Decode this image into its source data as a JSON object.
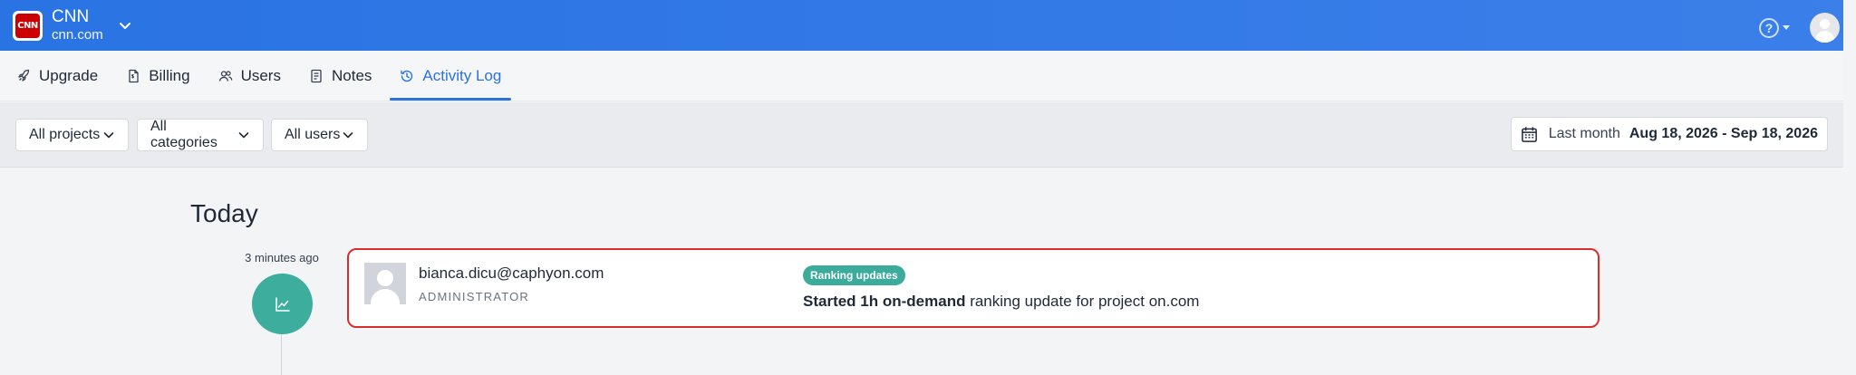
{
  "brand": {
    "name": "CNN",
    "domain": "cnn.com",
    "logo_text": "CNN",
    "logo_color": "#cc0000"
  },
  "topbar": {
    "help_glyph": "?",
    "color": "#2a73e3"
  },
  "tabs": [
    {
      "label": "Upgrade",
      "icon": "rocket-icon",
      "active": false
    },
    {
      "label": "Billing",
      "icon": "invoice-icon",
      "active": false
    },
    {
      "label": "Users",
      "icon": "users-icon",
      "active": false
    },
    {
      "label": "Notes",
      "icon": "notes-icon",
      "active": false
    },
    {
      "label": "Activity Log",
      "icon": "history-icon",
      "active": true
    }
  ],
  "filters": {
    "projects": "All projects",
    "categories": "All categories",
    "users": "All users",
    "date_label": "Last month",
    "date_range": "Aug 18, 2026 - Sep 18, 2026"
  },
  "activity": {
    "day_heading": "Today",
    "events": [
      {
        "timestamp": "3 minutes ago",
        "icon": "chart-line-icon",
        "user_email": "bianca.dicu@caphyon.com",
        "user_role": "ADMINISTRATOR",
        "category_badge": "Ranking updates",
        "description_bold": "Started 1h on-demand",
        "description_rest": " ranking update for project on.com"
      }
    ]
  },
  "colors": {
    "accent": "#2b72e0",
    "badge": "#3bab9c",
    "highlight_border": "#d92e2e"
  }
}
